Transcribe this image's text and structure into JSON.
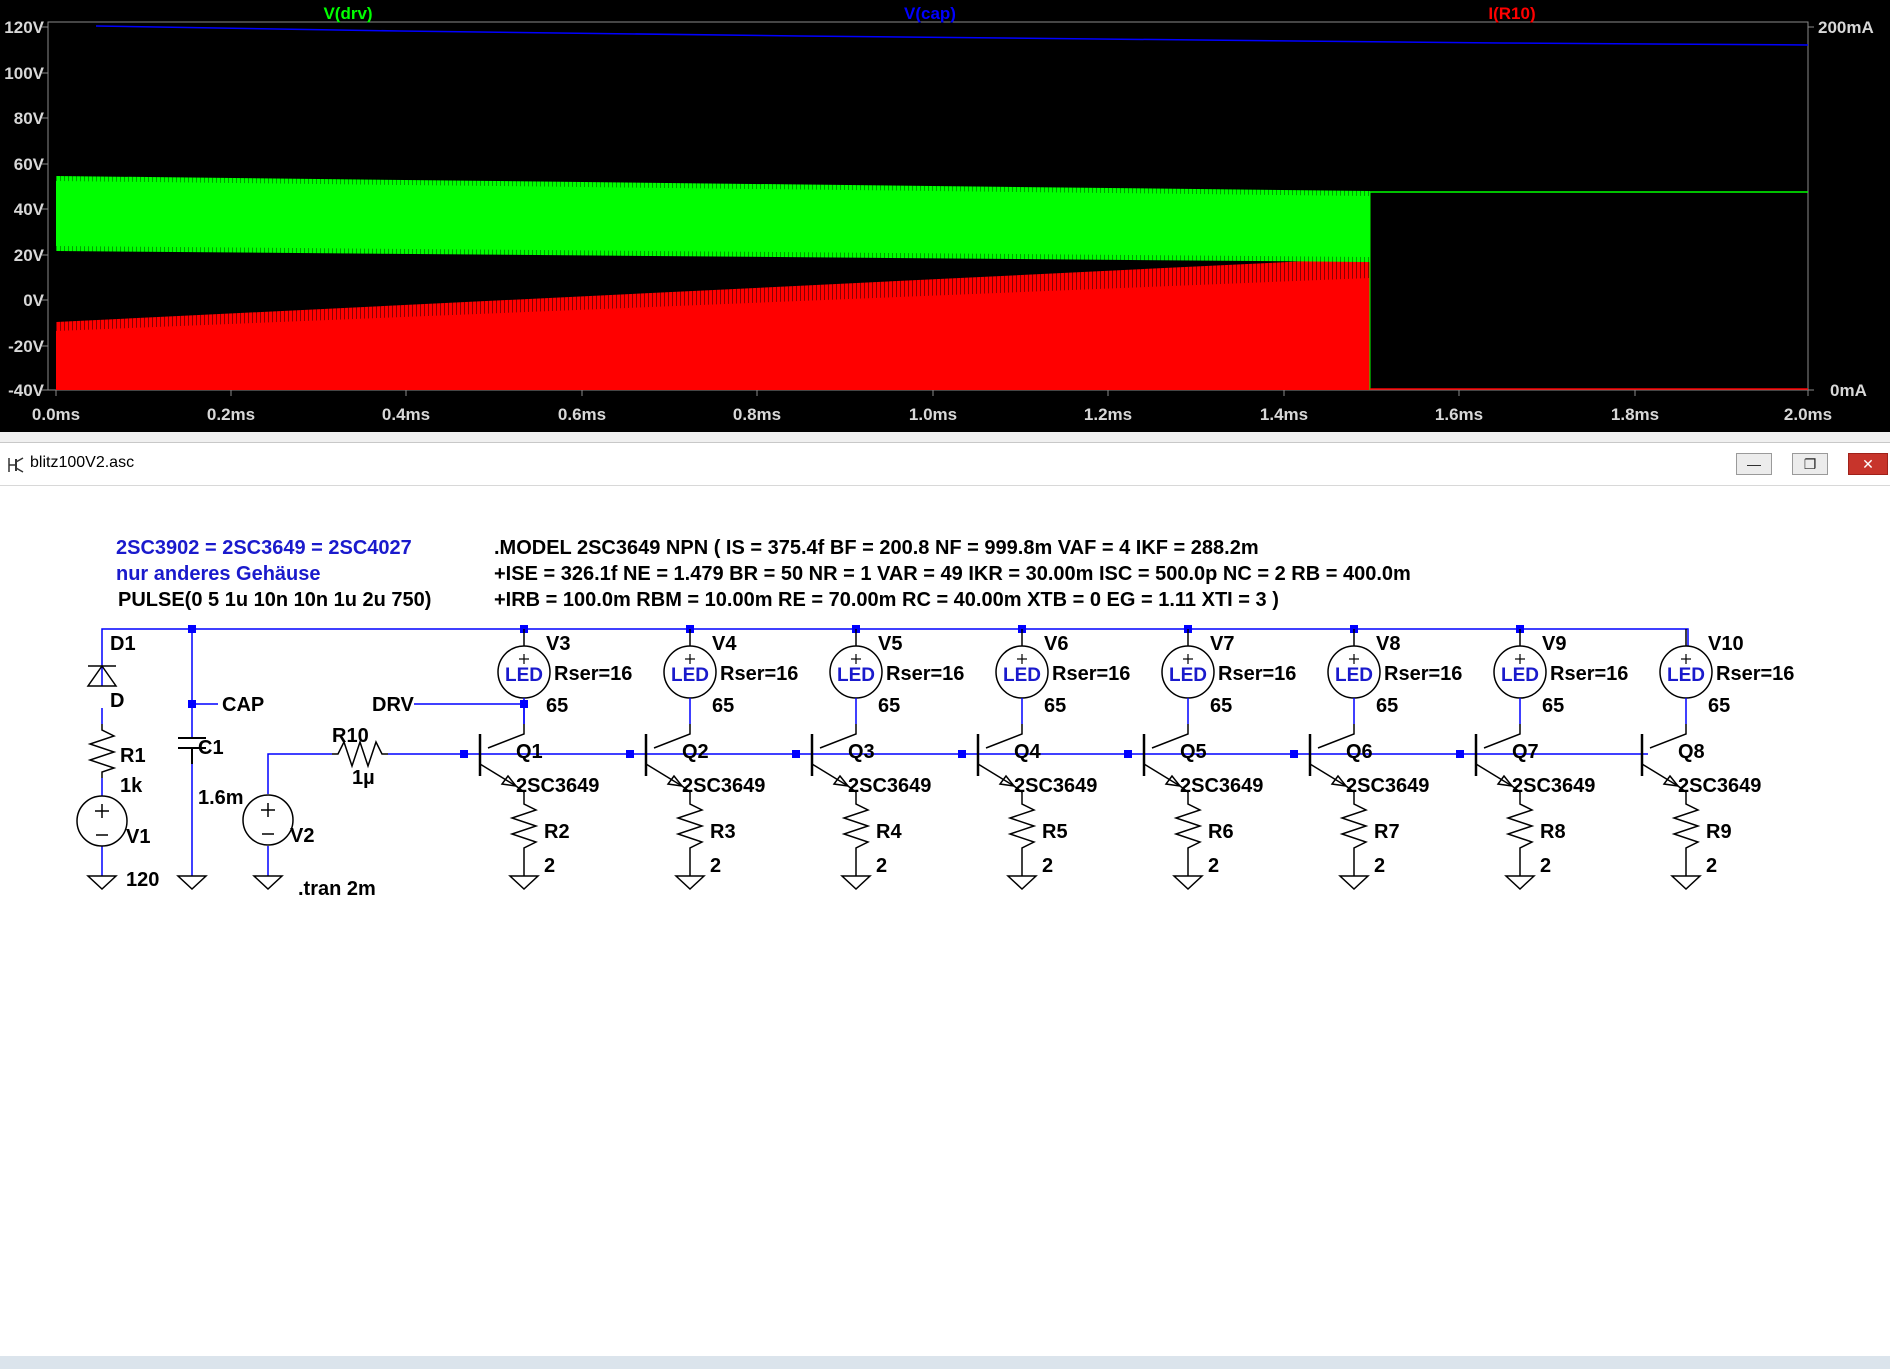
{
  "plot": {
    "traces": [
      {
        "label": "V(drv)",
        "color": "#00ff00"
      },
      {
        "label": "V(cap)",
        "color": "#0000ff"
      },
      {
        "label": "I(R10)",
        "color": "#ff0000"
      }
    ],
    "left_axis_ticks": [
      "120V",
      "100V",
      "80V",
      "60V",
      "40V",
      "20V",
      "0V",
      "-20V",
      "-40V"
    ],
    "right_axis_ticks": [
      "200mA",
      "0mA"
    ],
    "x_axis_ticks": [
      "0.0ms",
      "0.2ms",
      "0.4ms",
      "0.6ms",
      "0.8ms",
      "1.0ms",
      "1.2ms",
      "1.4ms",
      "1.6ms",
      "1.8ms",
      "2.0ms"
    ]
  },
  "window": {
    "title": "blitz100V2.asc",
    "minimize_label": "—",
    "maximize_label": "❐",
    "close_label": "✕"
  },
  "notes": {
    "equiv": "2SC3902 = 2SC3649 = 2SC4027",
    "housing": "nur anderes Gehäuse",
    "pulse": "PULSE(0 5 1u 10n 10n 1u 2u 750)",
    "model_1": ".MODEL 2SC3649 NPN ( IS = 375.4f BF = 200.8 NF = 999.8m VAF = 4 IKF = 288.2m",
    "model_2": "+ISE = 326.1f NE = 1.479 BR = 50 NR = 1 VAR = 49 IKR = 30.00m ISC = 500.0p NC = 2 RB = 400.0m",
    "model_3": "+IRB = 100.0m RBM = 10.00m RE = 70.00m RC = 40.00m XTB = 0 EG = 1.11 XTI = 3 )",
    "tran": ".tran 2m"
  },
  "components": {
    "D1": {
      "name": "D1",
      "value": "D"
    },
    "R1": {
      "name": "R1",
      "value": "1k"
    },
    "V1": {
      "name": "V1",
      "value": "120"
    },
    "C1": {
      "name": "C1",
      "value": "1.6m"
    },
    "V2": {
      "name": "V2"
    },
    "R10": {
      "name": "R10",
      "value": "1µ"
    },
    "net_cap": "CAP",
    "net_drv": "DRV",
    "led_symbol": "LED",
    "stages": [
      {
        "led": "V3",
        "rser": "Rser=16",
        "led_val": "65",
        "q": "Q1",
        "q_model": "2SC3649",
        "r": "R2",
        "r_val": "2"
      },
      {
        "led": "V4",
        "rser": "Rser=16",
        "led_val": "65",
        "q": "Q2",
        "q_model": "2SC3649",
        "r": "R3",
        "r_val": "2"
      },
      {
        "led": "V5",
        "rser": "Rser=16",
        "led_val": "65",
        "q": "Q3",
        "q_model": "2SC3649",
        "r": "R4",
        "r_val": "2"
      },
      {
        "led": "V6",
        "rser": "Rser=16",
        "led_val": "65",
        "q": "Q4",
        "q_model": "2SC3649",
        "r": "R5",
        "r_val": "2"
      },
      {
        "led": "V7",
        "rser": "Rser=16",
        "led_val": "65",
        "q": "Q5",
        "q_model": "2SC3649",
        "r": "R6",
        "r_val": "2"
      },
      {
        "led": "V8",
        "rser": "Rser=16",
        "led_val": "65",
        "q": "Q6",
        "q_model": "2SC3649",
        "r": "R7",
        "r_val": "2"
      },
      {
        "led": "V9",
        "rser": "Rser=16",
        "led_val": "65",
        "q": "Q7",
        "q_model": "2SC3649",
        "r": "R8",
        "r_val": "2"
      },
      {
        "led": "V10",
        "rser": "Rser=16",
        "led_val": "65",
        "q": "Q8",
        "q_model": "2SC3649",
        "r": "R9",
        "r_val": "2"
      }
    ]
  }
}
